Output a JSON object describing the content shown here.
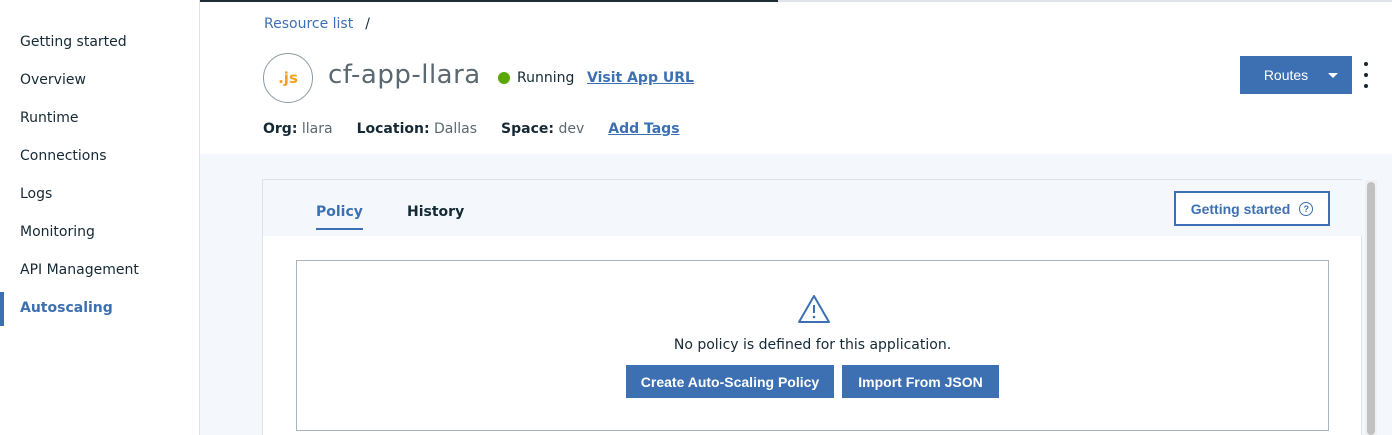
{
  "sidebar": {
    "items": [
      {
        "label": "Getting started"
      },
      {
        "label": "Overview"
      },
      {
        "label": "Runtime"
      },
      {
        "label": "Connections"
      },
      {
        "label": "Logs"
      },
      {
        "label": "Monitoring"
      },
      {
        "label": "API Management"
      },
      {
        "label": "Autoscaling",
        "active": true
      }
    ]
  },
  "breadcrumb": {
    "root": "Resource list",
    "separator": "/"
  },
  "app": {
    "icon_text": ".js",
    "name": "cf-app-llara",
    "status": "Running",
    "status_color": "#5aa700",
    "visit_link": "Visit App URL"
  },
  "meta": {
    "org_key": "Org:",
    "org_val": "llara",
    "location_key": "Location:",
    "location_val": "Dallas",
    "space_key": "Space:",
    "space_val": "dev",
    "add_tags": "Add Tags"
  },
  "header_actions": {
    "routes_label": "Routes"
  },
  "tabs": [
    {
      "label": "Policy",
      "active": true
    },
    {
      "label": "History"
    }
  ],
  "getting_started_button": "Getting started",
  "empty_state": {
    "message": "No policy is defined for this application.",
    "create_button": "Create Auto-Scaling Policy",
    "import_button": "Import From JSON"
  },
  "colors": {
    "accent": "#3d70b2",
    "js_icon": "#f7a11a"
  }
}
